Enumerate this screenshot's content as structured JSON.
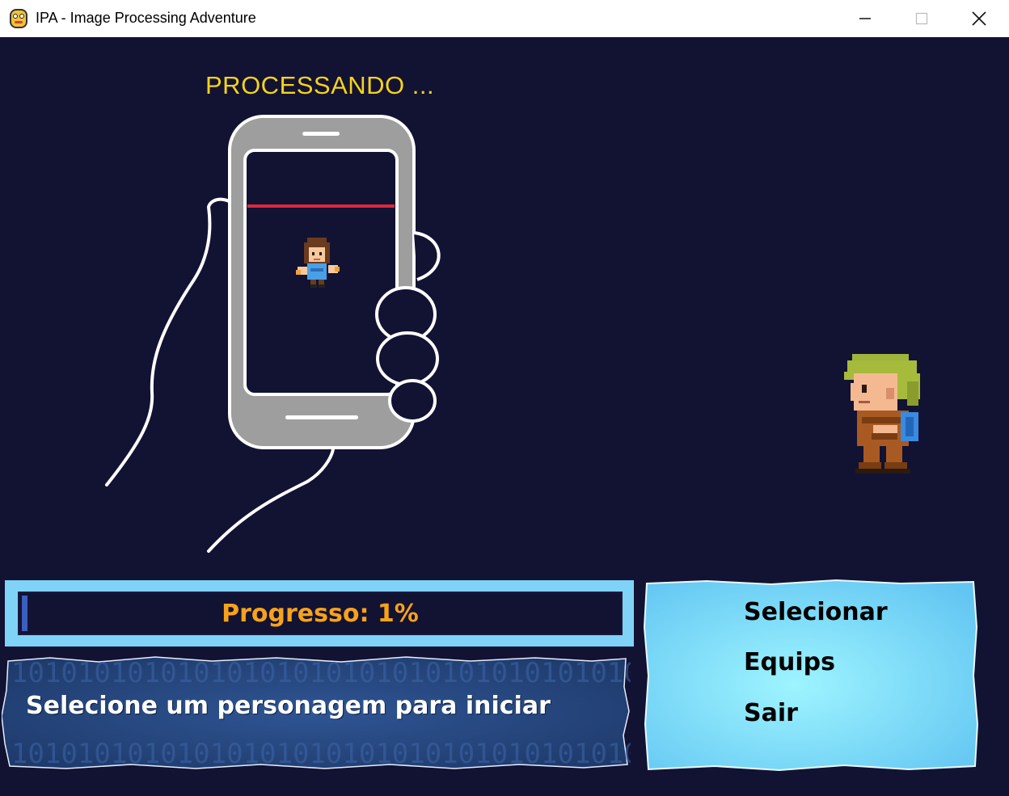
{
  "window": {
    "title": "IPA - Image Processing Adventure",
    "icon": "python-snake-icon",
    "controls": [
      "minimize-icon",
      "maximize-icon",
      "close-icon"
    ]
  },
  "scene": {
    "status_text": "PROCESSANDO ...",
    "colors": {
      "background": "#121233",
      "status": "#f5d31a",
      "scan_line": "#e0283c",
      "phone_body": "#9e9e9e"
    }
  },
  "progress": {
    "label": "Progresso: 1%",
    "value_percent": 1,
    "label_color": "#f7a21b"
  },
  "message": {
    "text": "Selecione um personagem para iniciar",
    "pattern_digits": "10101010101010101010"
  },
  "menu": {
    "items": [
      {
        "label": "Selecionar"
      },
      {
        "label": "Equips"
      },
      {
        "label": "Sair"
      }
    ]
  }
}
